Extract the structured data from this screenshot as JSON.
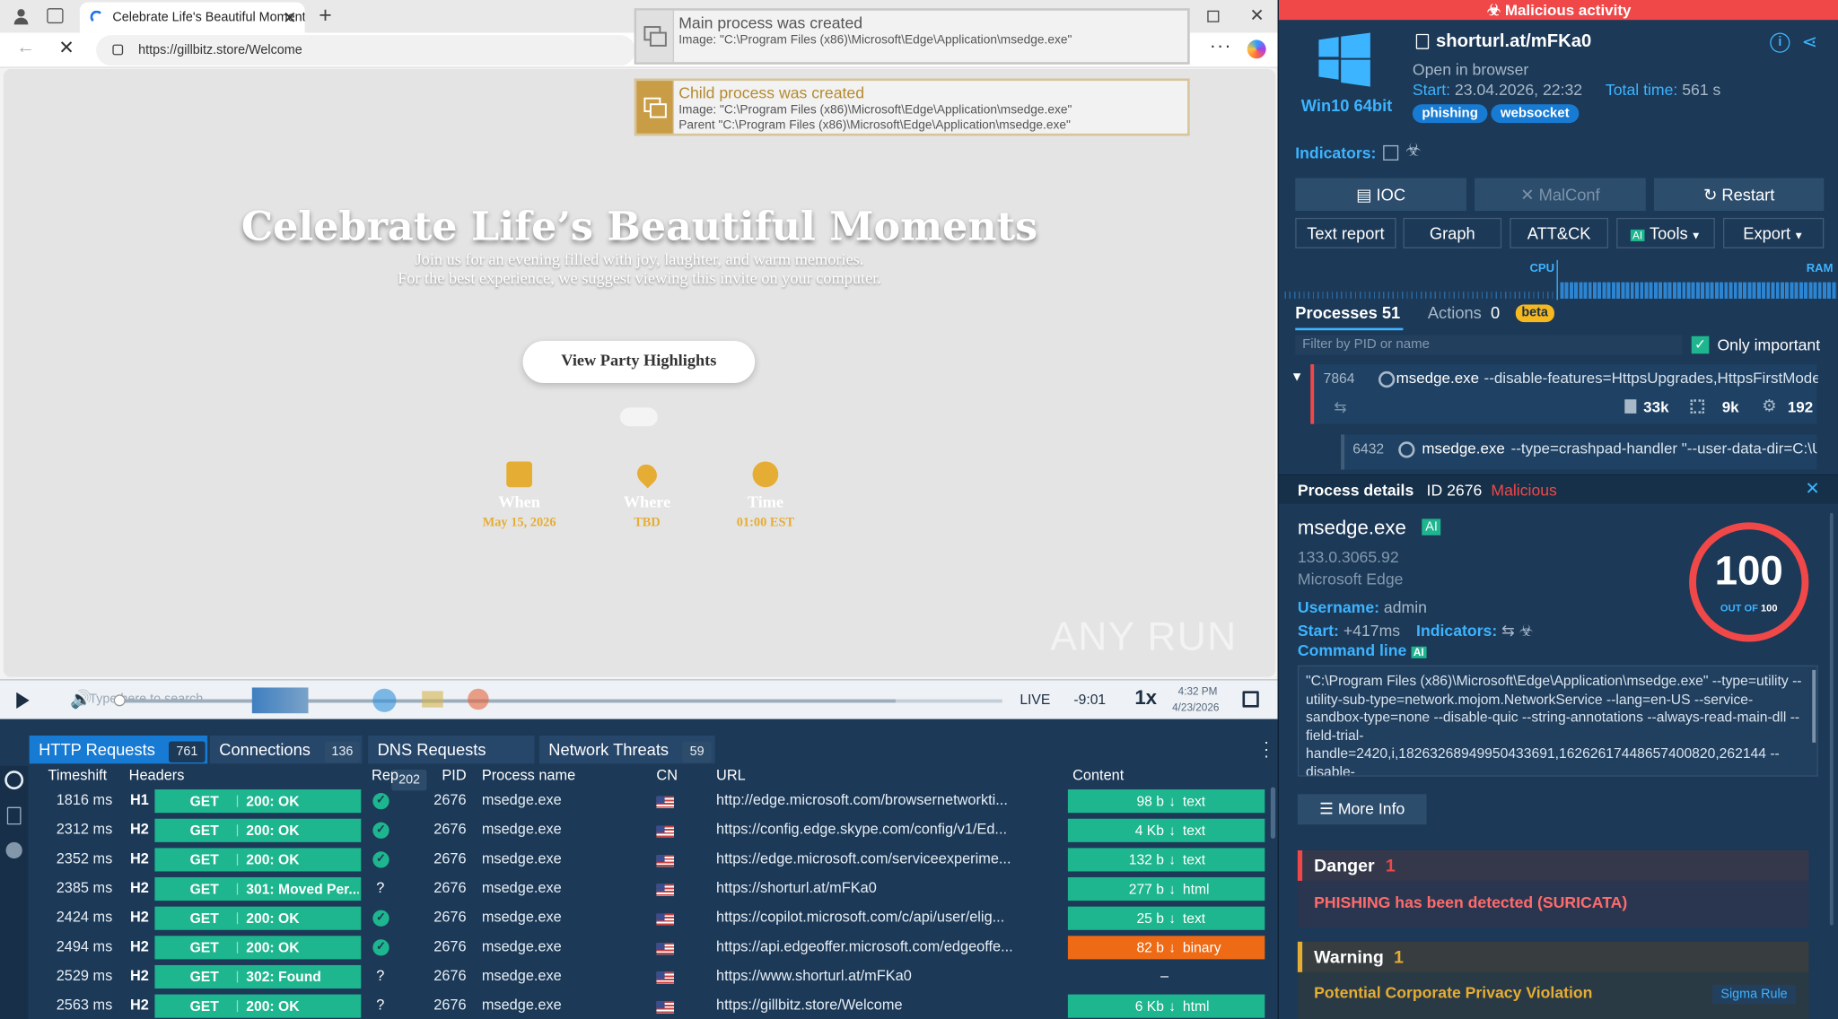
{
  "browser": {
    "tab_title": "Celebrate Life's Beautiful Moment",
    "url": "https://gillbitz.store/Welcome"
  },
  "popups": [
    {
      "title": "Main process was created",
      "line1": "Image: \"C:\\Program Files (x86)\\Microsoft\\Edge\\Application\\msedge.exe\"",
      "line2": ""
    },
    {
      "title": "Child process was created",
      "line1": "Image: \"C:\\Program Files (x86)\\Microsoft\\Edge\\Application\\msedge.exe\"",
      "line2": "Parent \"C:\\Program Files (x86)\\Microsoft\\Edge\\Application\\msedge.exe\""
    }
  ],
  "page": {
    "heading": "Celebrate Life’s Beautiful Moments",
    "sub1": "Join us for an evening filled with joy, laughter, and warm memories.",
    "sub2": "For the best experience, we suggest viewing this invite on your computer.",
    "cta": "View Party Highlights",
    "info": [
      {
        "label": "When",
        "value": "May 15, 2026"
      },
      {
        "label": "Where",
        "value": "TBD"
      },
      {
        "label": "Time",
        "value": "01:00 EST"
      }
    ],
    "watermark": "ANY RUN"
  },
  "player": {
    "search_placeholder": "Type here to search",
    "live": "LIVE",
    "time_offset": "-9:01",
    "speed": "1x",
    "clock_time": "4:32 PM",
    "clock_date": "4/23/2026"
  },
  "net": {
    "tabs": [
      {
        "label": "HTTP Requests",
        "count": "761"
      },
      {
        "label": "Connections",
        "count": "136"
      },
      {
        "label": "DNS Requests",
        "count": "202"
      },
      {
        "label": "Network Threats",
        "count": "59"
      }
    ],
    "headers": {
      "timeshift": "Timeshift",
      "headers": "Headers",
      "rep": "Rep",
      "pid": "PID",
      "process": "Process name",
      "cn": "CN",
      "url": "URL",
      "content": "Content"
    },
    "rows": [
      {
        "time": "1816 ms",
        "proto": "H1",
        "method": "GET",
        "status": "200: OK",
        "rep": "ok",
        "pid": "2676",
        "proc": "msedge.exe",
        "url": "http://edge.microsoft.com/browsernetworkti...",
        "size": "98 b",
        "type": "text"
      },
      {
        "time": "2312 ms",
        "proto": "H2",
        "method": "GET",
        "status": "200: OK",
        "rep": "ok",
        "pid": "2676",
        "proc": "msedge.exe",
        "url": "https://config.edge.skype.com/config/v1/Ed...",
        "size": "4 Kb",
        "type": "text"
      },
      {
        "time": "2352 ms",
        "proto": "H2",
        "method": "GET",
        "status": "200: OK",
        "rep": "ok",
        "pid": "2676",
        "proc": "msedge.exe",
        "url": "https://edge.microsoft.com/serviceexperime...",
        "size": "132 b",
        "type": "text"
      },
      {
        "time": "2385 ms",
        "proto": "H2",
        "method": "GET",
        "status": "301: Moved Per...",
        "rep": "?",
        "pid": "2676",
        "proc": "msedge.exe",
        "url": "https://shorturl.at/mFKa0",
        "size": "277 b",
        "type": "html"
      },
      {
        "time": "2424 ms",
        "proto": "H2",
        "method": "GET",
        "status": "200: OK",
        "rep": "ok",
        "pid": "2676",
        "proc": "msedge.exe",
        "url": "https://copilot.microsoft.com/c/api/user/elig...",
        "size": "25 b",
        "type": "text"
      },
      {
        "time": "2494 ms",
        "proto": "H2",
        "method": "GET",
        "status": "200: OK",
        "rep": "ok",
        "pid": "2676",
        "proc": "msedge.exe",
        "url": "https://api.edgeoffer.microsoft.com/edgeoffe...",
        "size": "82 b",
        "type": "binary"
      },
      {
        "time": "2529 ms",
        "proto": "H2",
        "method": "GET",
        "status": "302: Found",
        "rep": "?",
        "pid": "2676",
        "proc": "msedge.exe",
        "url": "https://www.shorturl.at/mFKa0",
        "size": "",
        "type": ""
      },
      {
        "time": "2563 ms",
        "proto": "H2",
        "method": "GET",
        "status": "200: OK",
        "rep": "?",
        "pid": "2676",
        "proc": "msedge.exe",
        "url": "https://gillbitz.store/Welcome",
        "size": "6 Kb",
        "type": "html"
      }
    ],
    "empty_content": "–"
  },
  "right": {
    "banner": "Malicious activity",
    "os": "Win10 64bit",
    "task_title": "shorturl.at/mFKa0",
    "open_in": "Open in browser",
    "start_label": "Start:",
    "start_value": "23.04.2026, 22:32",
    "total_label": "Total time:",
    "total_value": "561 s",
    "tags": [
      "phishing",
      "websocket"
    ],
    "indicators_label": "Indicators:",
    "buttons": {
      "ioc": "IOC",
      "malconf": "MalConf",
      "restart": "Restart",
      "text_report": "Text report",
      "graph": "Graph",
      "attck": "ATT&CK",
      "ai": "AI",
      "tools": "Tools",
      "export": "Export"
    },
    "cpu": "CPU",
    "ram": "RAM",
    "processes_label": "Processes",
    "processes_count": "51",
    "actions_label": "Actions",
    "actions_count": "0",
    "beta": "beta",
    "filter_placeholder": "Filter by PID or name",
    "only_important": "Only important",
    "proc1": {
      "pid": "7864",
      "name": "msedge.exe",
      "args": "--disable-features=HttpsUpgrades,HttpsFirstMode...",
      "files": "33k",
      "reg": "9k",
      "mods": "192"
    },
    "proc2": {
      "pid": "6432",
      "name": "msedge.exe",
      "args": "--type=crashpad-handler \"--user-data-dir=C:\\U..."
    },
    "details": {
      "title": "Process details",
      "id_label": "ID 2676",
      "verdict": "Malicious",
      "name": "msedge.exe",
      "ai": "AI",
      "version": "133.0.3065.92",
      "vendor": "Microsoft Edge",
      "username_label": "Username:",
      "username": "admin",
      "start_label": "Start:",
      "start": "+417ms",
      "indicators_label": "Indicators:",
      "cmd_label": "Command line",
      "cmd": "\"C:\\Program Files (x86)\\Microsoft\\Edge\\Application\\msedge.exe\" --type=utility --utility-sub-type=network.mojom.NetworkService --lang=en-US --service-sandbox-type=none --disable-quic --string-annotations --always-read-main-dll --field-trial-handle=2420,i,18263268949950433691,16262617448657400820,262144 --disable-",
      "score": "100",
      "score_sub": "OUT OF",
      "score_max": "100",
      "more_info": "More Info"
    },
    "danger_label": "Danger",
    "danger_count": "1",
    "danger_text": "PHISHING has been detected (SURICATA)",
    "warning_label": "Warning",
    "warning_count": "1",
    "warning_text": "Potential Corporate Privacy Violation",
    "sigma": "Sigma Rule"
  },
  "colors": {
    "accent": "#3db4ff",
    "malicious": "#f04848",
    "ok": "#1eb68e",
    "binary": "#ee6a15",
    "gold": "#e6ad34"
  }
}
